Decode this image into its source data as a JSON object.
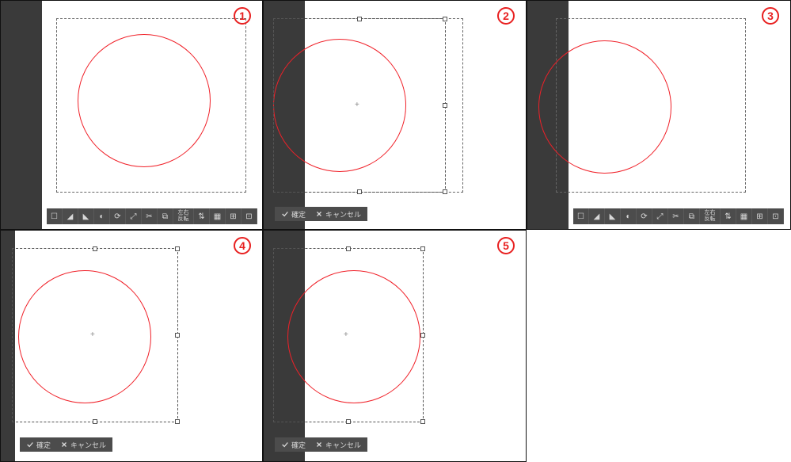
{
  "badges": {
    "p1": "1",
    "p2": "2",
    "p3": "3",
    "p4": "4",
    "p5": "5"
  },
  "confirm": {
    "ok_label": "確定",
    "cancel_label": "キャンセル"
  },
  "flip_label": "左右\n反転",
  "tool_icons": {
    "select": "☐",
    "crop": "◢",
    "levels": "◣",
    "hue": "◐",
    "rotate": "⟳",
    "scale": "⤢",
    "cut": "✂",
    "copy": "⧉",
    "fliph": "左右反転",
    "flipv": "⇅",
    "grid": "▦",
    "snap": "⊞",
    "guide": "⊡",
    "more": "⋯"
  }
}
